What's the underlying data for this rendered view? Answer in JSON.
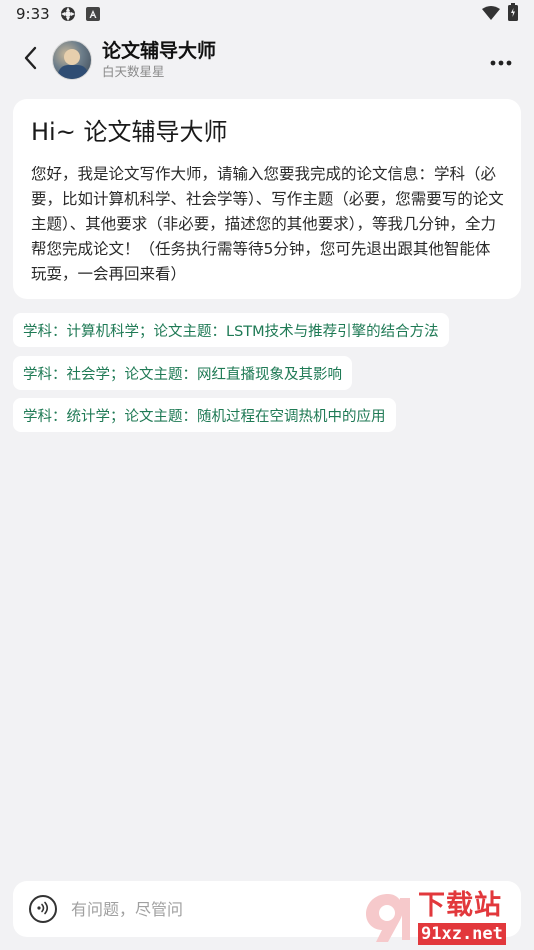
{
  "status_bar": {
    "time": "9:33"
  },
  "header": {
    "title": "论文辅导大师",
    "subtitle": "白天数星星"
  },
  "intro": {
    "title": "Hi~ 论文辅导大师",
    "body": "您好，我是论文写作大师，请输入您要我完成的论文信息：学科（必要，比如计算机科学、社会学等）、写作主题（必要，您需要写的论文主题）、其他要求（非必要，描述您的其他要求），等我几分钟，全力帮您完成论文！（任务执行需等待5分钟，您可先退出跟其他智能体玩耍，一会再回来看）"
  },
  "suggestions": [
    "学科：计算机科学；论文主题：LSTM技术与推荐引擎的结合方法",
    "学科：社会学；论文主题：网红直播现象及其影响",
    "学科：统计学；论文主题：随机过程在空调热机中的应用"
  ],
  "input": {
    "placeholder": "有问题，尽管问"
  },
  "watermark": {
    "name": "下载站",
    "domain": "91xz.net"
  },
  "colors": {
    "background": "#f2f2f4",
    "card": "#ffffff",
    "suggestion_text": "#1f7a55",
    "watermark": "#e2383c"
  }
}
